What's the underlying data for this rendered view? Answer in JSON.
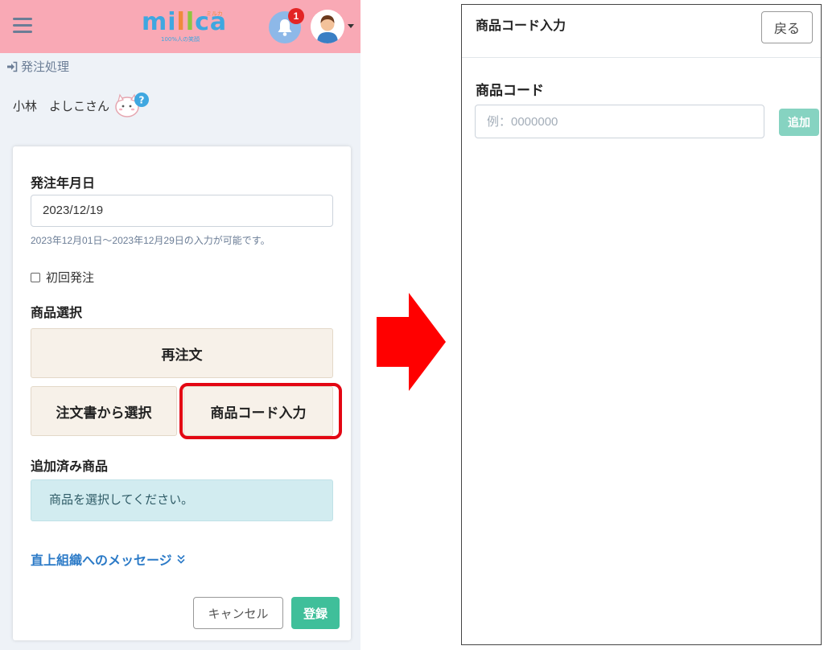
{
  "left": {
    "header": {
      "logo_text": "millca",
      "logo_kana": "ミルカ",
      "logo_sub": "100%人の笑顔",
      "notification_count": "1"
    },
    "breadcrumb": "発注処理",
    "user_name": "小林　よしこさん",
    "form": {
      "order_date_label": "発注年月日",
      "order_date_value": "2023/12/19",
      "order_date_help": "2023年12月01日～2023年12月29日の入力が可能です。",
      "first_order_label": "初回発注",
      "product_select_label": "商品選択",
      "reorder_button": "再注文",
      "from_order_sheet_button": "注文書から選択",
      "product_code_button": "商品コード入力",
      "added_products_label": "追加済み商品",
      "added_products_empty": "商品を選択してください。",
      "message_link": "直上組織へのメッセージ",
      "cancel_button": "キャンセル",
      "register_button": "登録"
    }
  },
  "right": {
    "title": "商品コード入力",
    "back_button": "戻る",
    "product_code_label": "商品コード",
    "product_code_placeholder": "例：0000000",
    "add_button": "追加"
  },
  "colors": {
    "header_pink": "#f9a9b5",
    "highlight_red": "#e30613",
    "arrow_red": "#ff0000",
    "register_green": "#3fbf9a",
    "add_green": "#86d3c1",
    "link_blue": "#2b7ac7"
  }
}
